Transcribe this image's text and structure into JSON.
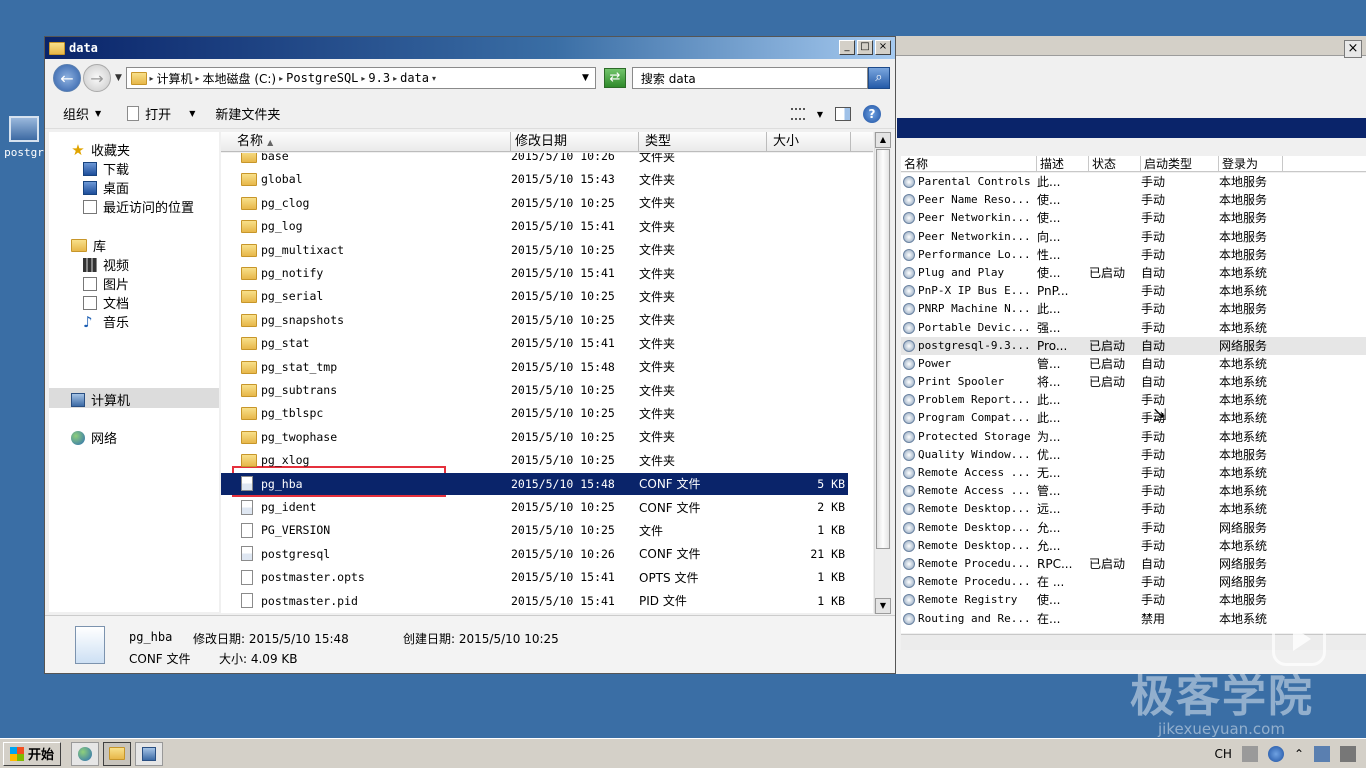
{
  "desktop": {
    "icon_label": "postgr"
  },
  "explorer": {
    "title": "data",
    "window_buttons": [
      "_",
      "□",
      "×"
    ],
    "breadcrumbs": [
      "计算机",
      "本地磁盘 (C:)",
      "PostgreSQL",
      "9.3",
      "data"
    ],
    "search_placeholder": "搜索 data",
    "toolbar": {
      "organize": "组织",
      "open": "打开",
      "new_folder": "新建文件夹"
    },
    "nav": {
      "favorites": "收藏夹",
      "downloads": "下载",
      "desktop": "桌面",
      "recent": "最近访问的位置",
      "libraries": "库",
      "videos": "视频",
      "pictures": "图片",
      "documents": "文档",
      "music": "音乐",
      "computer": "计算机",
      "network": "网络"
    },
    "columns": [
      "名称",
      "修改日期",
      "类型",
      "大小"
    ],
    "files": [
      {
        "name": "base",
        "date": "2015/5/10 10:26",
        "type": "文件夹",
        "size": "",
        "kind": "folder"
      },
      {
        "name": "global",
        "date": "2015/5/10 15:43",
        "type": "文件夹",
        "size": "",
        "kind": "folder"
      },
      {
        "name": "pg_clog",
        "date": "2015/5/10 10:25",
        "type": "文件夹",
        "size": "",
        "kind": "folder"
      },
      {
        "name": "pg_log",
        "date": "2015/5/10 15:41",
        "type": "文件夹",
        "size": "",
        "kind": "folder"
      },
      {
        "name": "pg_multixact",
        "date": "2015/5/10 10:25",
        "type": "文件夹",
        "size": "",
        "kind": "folder"
      },
      {
        "name": "pg_notify",
        "date": "2015/5/10 15:41",
        "type": "文件夹",
        "size": "",
        "kind": "folder"
      },
      {
        "name": "pg_serial",
        "date": "2015/5/10 10:25",
        "type": "文件夹",
        "size": "",
        "kind": "folder"
      },
      {
        "name": "pg_snapshots",
        "date": "2015/5/10 10:25",
        "type": "文件夹",
        "size": "",
        "kind": "folder"
      },
      {
        "name": "pg_stat",
        "date": "2015/5/10 15:41",
        "type": "文件夹",
        "size": "",
        "kind": "folder"
      },
      {
        "name": "pg_stat_tmp",
        "date": "2015/5/10 15:48",
        "type": "文件夹",
        "size": "",
        "kind": "folder"
      },
      {
        "name": "pg_subtrans",
        "date": "2015/5/10 10:25",
        "type": "文件夹",
        "size": "",
        "kind": "folder"
      },
      {
        "name": "pg_tblspc",
        "date": "2015/5/10 10:25",
        "type": "文件夹",
        "size": "",
        "kind": "folder"
      },
      {
        "name": "pg_twophase",
        "date": "2015/5/10 10:25",
        "type": "文件夹",
        "size": "",
        "kind": "folder"
      },
      {
        "name": "pg_xlog",
        "date": "2015/5/10 10:25",
        "type": "文件夹",
        "size": "",
        "kind": "folder"
      },
      {
        "name": "pg_hba",
        "date": "2015/5/10 15:48",
        "type": "CONF 文件",
        "size": "5 KB",
        "kind": "cfg",
        "selected": true
      },
      {
        "name": "pg_ident",
        "date": "2015/5/10 10:25",
        "type": "CONF 文件",
        "size": "2 KB",
        "kind": "cfg"
      },
      {
        "name": "PG_VERSION",
        "date": "2015/5/10 10:25",
        "type": "文件",
        "size": "1 KB",
        "kind": "file"
      },
      {
        "name": "postgresql",
        "date": "2015/5/10 10:26",
        "type": "CONF 文件",
        "size": "21 KB",
        "kind": "cfg"
      },
      {
        "name": "postmaster.opts",
        "date": "2015/5/10 15:41",
        "type": "OPTS 文件",
        "size": "1 KB",
        "kind": "file"
      },
      {
        "name": "postmaster.pid",
        "date": "2015/5/10 15:41",
        "type": "PID 文件",
        "size": "1 KB",
        "kind": "file"
      }
    ],
    "details": {
      "name": "pg_hba",
      "type": "CONF 文件",
      "modified_label": "修改日期: 2015/5/10 15:48",
      "created_label": "创建日期: 2015/5/10 10:25",
      "size_label": "大小: 4.09 KB"
    }
  },
  "services": {
    "columns": [
      "名称",
      "描述",
      "状态",
      "启动类型",
      "登录为"
    ],
    "rows": [
      [
        "Parental Controls",
        "此...",
        "",
        "手动",
        "本地服务"
      ],
      [
        "Peer Name Reso...",
        "使...",
        "",
        "手动",
        "本地服务"
      ],
      [
        "Peer Networkin...",
        "使...",
        "",
        "手动",
        "本地服务"
      ],
      [
        "Peer Networkin...",
        "向...",
        "",
        "手动",
        "本地服务"
      ],
      [
        "Performance Lo...",
        "性...",
        "",
        "手动",
        "本地服务"
      ],
      [
        "Plug and Play",
        "使...",
        "已启动",
        "自动",
        "本地系统"
      ],
      [
        "PnP-X IP Bus E...",
        "PnP...",
        "",
        "手动",
        "本地系统"
      ],
      [
        "PNRP Machine N...",
        "此...",
        "",
        "手动",
        "本地服务"
      ],
      [
        "Portable Devic...",
        "强...",
        "",
        "手动",
        "本地系统"
      ],
      [
        "postgresql-9.3...",
        "Pro...",
        "已启动",
        "自动",
        "网络服务"
      ],
      [
        "Power",
        "管...",
        "已启动",
        "自动",
        "本地系统"
      ],
      [
        "Print Spooler",
        "将...",
        "已启动",
        "自动",
        "本地系统"
      ],
      [
        "Problem Report...",
        "此...",
        "",
        "手动",
        "本地系统"
      ],
      [
        "Program Compat...",
        "此...",
        "",
        "手动",
        "本地系统"
      ],
      [
        "Protected Storage",
        "为...",
        "",
        "手动",
        "本地系统"
      ],
      [
        "Quality Window...",
        "优...",
        "",
        "手动",
        "本地服务"
      ],
      [
        "Remote Access ...",
        "无...",
        "",
        "手动",
        "本地系统"
      ],
      [
        "Remote Access ...",
        "管...",
        "",
        "手动",
        "本地系统"
      ],
      [
        "Remote Desktop...",
        "远...",
        "",
        "手动",
        "本地系统"
      ],
      [
        "Remote Desktop...",
        "允...",
        "",
        "手动",
        "网络服务"
      ],
      [
        "Remote Desktop...",
        "允...",
        "",
        "手动",
        "本地系统"
      ],
      [
        "Remote Procedu...",
        "RPC...",
        "已启动",
        "自动",
        "网络服务"
      ],
      [
        "Remote Procedu...",
        "在 ...",
        "",
        "手动",
        "网络服务"
      ],
      [
        "Remote Registry",
        "使...",
        "",
        "手动",
        "本地服务"
      ],
      [
        "Routing and Re...",
        "在...",
        "",
        "禁用",
        "本地系统"
      ]
    ]
  },
  "taskbar": {
    "start": "开始",
    "lang": "CH"
  },
  "watermark": {
    "big": "极客学院",
    "small": "jikexueyuan.com"
  }
}
